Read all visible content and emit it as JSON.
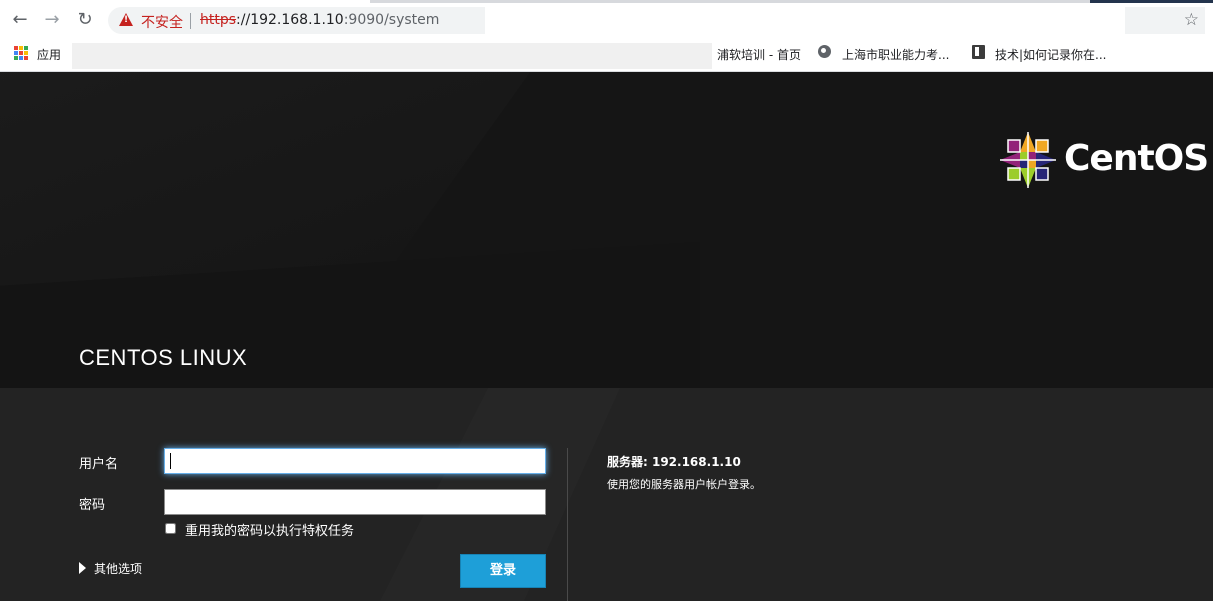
{
  "browser": {
    "insecure_label": "不安全",
    "url_scheme": "https",
    "url_host": "://192.168.1.10",
    "url_rest": ":9090/system",
    "bookmarks": {
      "apps_label": "应用",
      "items": [
        "浦软培训 - 首页",
        "上海市职业能力考...",
        "技术|如何记录你在..."
      ]
    }
  },
  "page": {
    "brand": "CENTOS LINUX",
    "logo_text": "CentOS",
    "form": {
      "username_label": "用户名",
      "password_label": "密码",
      "reuse_label": "重用我的密码以执行特权任务",
      "other_options": "其他选项",
      "login_button": "登录"
    },
    "server": {
      "label": "服务器: 192.168.1.10",
      "description": "使用您的服务器用户帐户登录。"
    }
  },
  "colors": {
    "accent": "#1e9fd8",
    "insecure": "#c5221f",
    "background": "#202020"
  }
}
